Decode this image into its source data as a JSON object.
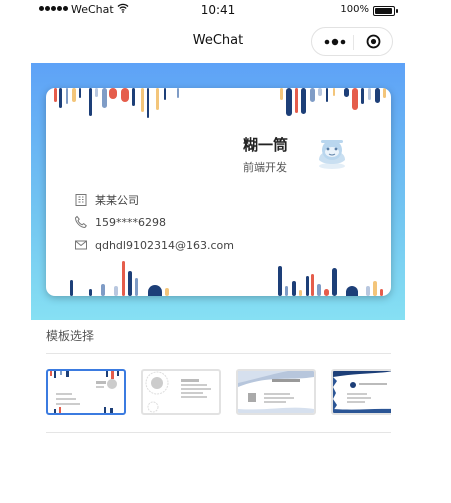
{
  "status_bar": {
    "carrier": "WeChat",
    "time": "10:41",
    "battery": "100%"
  },
  "nav": {
    "title": "WeChat"
  },
  "card": {
    "name": "糊一筒",
    "title": "前端开发",
    "company": "某某公司",
    "phone": "159****6298",
    "email": "qdhdl9102314@163.com"
  },
  "templates_section": {
    "title": "模板选择"
  },
  "colors": {
    "accent": "#3b7be0",
    "hero_top": "#5ea2f7",
    "hero_bottom": "#86e0f3"
  }
}
